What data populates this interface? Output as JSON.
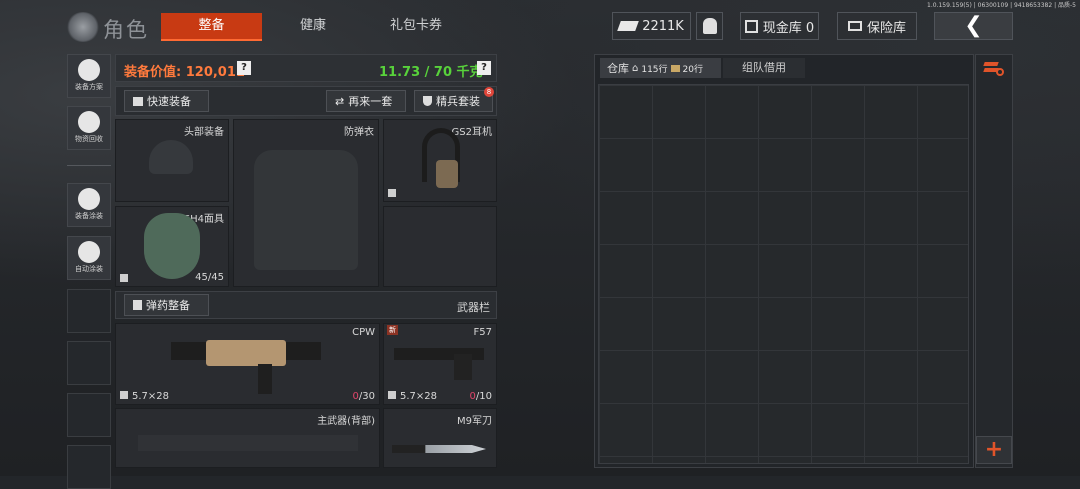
{
  "build_info": "1.0.159.159(5) | 06300109 | 9418653382 | 品质-5",
  "header": {
    "title": "角色",
    "tabs": [
      {
        "label": "整备",
        "active": true
      },
      {
        "label": "健康",
        "active": false
      },
      {
        "label": "礼包卡券",
        "active": false
      }
    ],
    "currency": "2211K",
    "cash_vault": "现金库 0",
    "safe_box": "保险库"
  },
  "sidebar": {
    "items": [
      {
        "label": "装备方案",
        "icon": "gear-plan-icon"
      },
      {
        "label": "物资回收",
        "icon": "recycle-icon"
      },
      {
        "label": "装备涂装",
        "icon": "paint-icon"
      },
      {
        "label": "自动涂装",
        "icon": "auto-paint-icon"
      }
    ]
  },
  "equipment": {
    "value_label": "装备价值:",
    "value": "120,011",
    "weight": "11.73 / 70 千克",
    "help": "?",
    "quick_equip": "快速装备",
    "again": "再来一套",
    "elite_set": "精兵套装",
    "elite_badge": "8",
    "slots": {
      "head": "头部装备",
      "armor": "防弹衣",
      "earphone": "GS2耳机",
      "mask": "SH4面具",
      "mask_count": "45/45"
    },
    "ammo_btn": "弹药整备",
    "weapon_bar": "武器栏",
    "weapons": {
      "primary_name": "CPW",
      "primary_caliber": "5.7×28",
      "primary_ammo_cur": "0",
      "primary_ammo_max": "/30",
      "sidearm_name": "F57",
      "sidearm_badge": "新",
      "sidearm_caliber": "5.7×28",
      "sidearm_ammo_cur": "0",
      "sidearm_ammo_max": "/10",
      "back_label": "主武器(背部)",
      "knife": "M9军刀"
    }
  },
  "warehouse": {
    "tab": "仓库",
    "rows_a": "115行",
    "rows_b": "20行",
    "team_borrow": "组队借用"
  },
  "colors": {
    "accent": "#c83a13",
    "weight_green": "#58d23b",
    "value_orange": "#ff7a3d"
  }
}
